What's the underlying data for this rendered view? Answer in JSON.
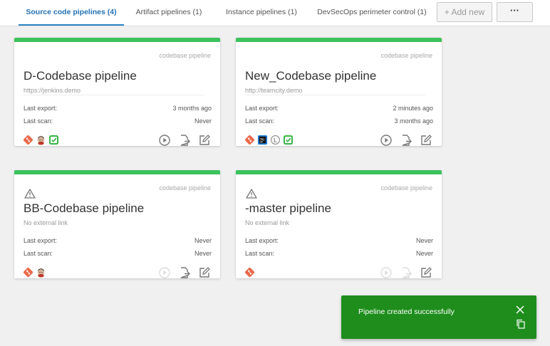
{
  "tabs": [
    {
      "label": "Source code pipelines (4)",
      "active": true
    },
    {
      "label": "Artifact pipelines (1)",
      "active": false
    },
    {
      "label": "Instance pipelines (1)",
      "active": false
    },
    {
      "label": "DevSecOps perimeter control (1)",
      "active": false
    }
  ],
  "toolbar": {
    "add_new_label": "+ Add new",
    "more_label": "···"
  },
  "labels": {
    "last_export": "Last export:",
    "last_scan": "Last scan:"
  },
  "colors": {
    "accent": "#3cc25c",
    "tab_active": "#2271b5",
    "toast_bg": "#1e8d1c",
    "git_icon": "#e96b4c",
    "check_icon": "#3cb54a"
  },
  "cards": [
    {
      "type": "codebase pipeline",
      "name": "D-Codebase pipeline",
      "link": "https://jenkins.demo",
      "warning": false,
      "last_export": "3 months ago",
      "last_scan": "Never",
      "integration_icons": [
        "git-icon",
        "jenkins-icon",
        "checklist-icon"
      ],
      "actions_enabled": true
    },
    {
      "type": "codebase pipeline",
      "name": "New_Codebase pipeline",
      "link": "http://teamcity.demo",
      "warning": false,
      "last_export": "2 minutes ago",
      "last_scan": "3 months ago",
      "integration_icons": [
        "git-icon",
        "teamcity-icon",
        "l-icon",
        "checklist-icon"
      ],
      "actions_enabled": true
    },
    {
      "type": "codebase pipeline",
      "name": "BB-Codebase pipeline",
      "link": "No external link",
      "warning": true,
      "last_export": "Never",
      "last_scan": "Never",
      "integration_icons": [
        "git-icon",
        "jenkins-icon"
      ],
      "actions_enabled": false
    },
    {
      "type": "codebase pipeline",
      "name": "-master pipeline",
      "link": "No external link",
      "warning": true,
      "last_export": "Never",
      "last_scan": "Never",
      "integration_icons": [
        "git-icon"
      ],
      "actions_enabled": false
    }
  ],
  "toast": {
    "message": "Pipeline created successfully"
  }
}
